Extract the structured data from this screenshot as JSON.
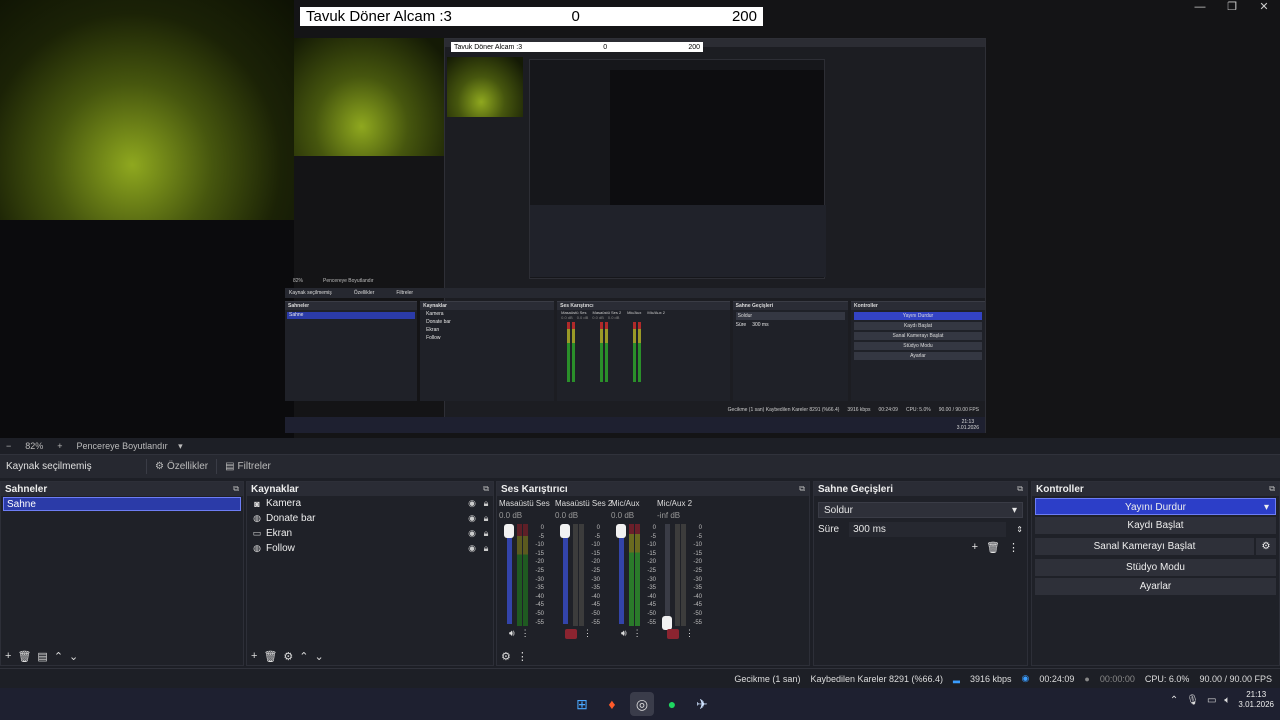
{
  "overlay": {
    "title": "Tavuk Döner Alcam :3",
    "min": "0",
    "max": "200"
  },
  "window_controls": [
    "—",
    "❐",
    "✕"
  ],
  "zoom": {
    "minus": "−",
    "percent": "82%",
    "plus": "+",
    "fit": "Pencereye Boyutlandır"
  },
  "source_toolbar": {
    "no_selection": "Kaynak seçilmemiş",
    "properties": "Özellikler",
    "filters": "Filtreler"
  },
  "scenes": {
    "title": "Sahneler",
    "items": [
      "Sahne"
    ]
  },
  "sources": {
    "title": "Kaynaklar",
    "items": [
      {
        "name": "Kamera",
        "icon": "camera-icon"
      },
      {
        "name": "Donate bar",
        "icon": "browser-icon"
      },
      {
        "name": "Ekran",
        "icon": "monitor-icon"
      },
      {
        "name": "Follow",
        "icon": "browser-icon"
      }
    ]
  },
  "mixer": {
    "title": "Ses Karıştırıcı",
    "channels": [
      {
        "name": "Masaüstü Ses",
        "db": "0.0 dB",
        "muted": false
      },
      {
        "name": "Masaüstü Ses 2",
        "db": "0.0 dB",
        "muted": true
      },
      {
        "name": "Mic/Aux",
        "db": "0.0 dB",
        "muted": false
      },
      {
        "name": "Mic/Aux 2",
        "db": "-inf dB",
        "muted": true
      }
    ],
    "scale": [
      "0",
      "-5",
      "-10",
      "-15",
      "-20",
      "-25",
      "-30",
      "-35",
      "-40",
      "-45",
      "-50",
      "-55",
      "-60"
    ]
  },
  "transitions": {
    "title": "Sahne Geçişleri",
    "selected": "Soldur",
    "duration_label": "Süre",
    "duration": "300 ms"
  },
  "controls": {
    "title": "Kontroller",
    "buttons": [
      "Yayını Durdur",
      "Kaydı Başlat",
      "Sanal Kamerayı Başlat",
      "Stüdyo Modu",
      "Ayarlar"
    ]
  },
  "status": {
    "delay": "Gecikme (1 san)",
    "dropped": "Kaybedilen Kareler 8291 (%66.4)",
    "kbps": "3916 kbps",
    "stream_time": "00:24:09",
    "rec_time": "00:00:00",
    "cpu": "CPU: 6.0%",
    "fps": "90.00 / 90.00 FPS"
  },
  "taskbar": {
    "icons": [
      "windows-icon",
      "brave-icon",
      "obs-icon",
      "spotify-icon",
      "steam-icon"
    ],
    "time": "21:13",
    "date": "3.01.2026"
  },
  "nested": {
    "scenes": "Sahneler",
    "sources": "Kaynaklar",
    "mixer": "Ses Karıştırıcı",
    "transitions": "Sahne Geçişleri",
    "controls": "Kontroller",
    "scene_item": "Sahne",
    "src_items": [
      "Kamera",
      "Donate bar",
      "Ekran",
      "Follow"
    ],
    "no_selection": "Kaynak seçilmemiş",
    "zoom": "82%",
    "fit": "Pencereye Boyutlandır",
    "properties": "Özellikler",
    "filters": "Filtreler",
    "mixer_channels": [
      "Masaüstü Ses",
      "Masaüstü Ses 2",
      "Mic/Aux",
      "Mic/Aux 2"
    ],
    "mixer_db": [
      "0.0 dB",
      "0.0 dB",
      "0.0 dB",
      "0.0 dB"
    ],
    "transition": "Soldur",
    "duration_label": "Süre",
    "duration": "300 ms",
    "controls_buttons": [
      "Yayını Durdur",
      "Kaydı Başlat",
      "Sanal Kamerayı Başlat",
      "Stüdyo Modu",
      "Ayarlar"
    ],
    "status": "Gecikme (1 san)   Kaybedilen Kareler 8291 (%66.4)",
    "kbps": "3916 kbps",
    "stream_time": "00:24:09",
    "cpu": "CPU: 5.0%",
    "fps": "90.00 / 90.00 FPS",
    "time": "21:13",
    "date": "3.01.2026"
  },
  "colors": {
    "accent": "#2c3ec8",
    "panel": "#1f2128",
    "background": "#1d1f26"
  }
}
